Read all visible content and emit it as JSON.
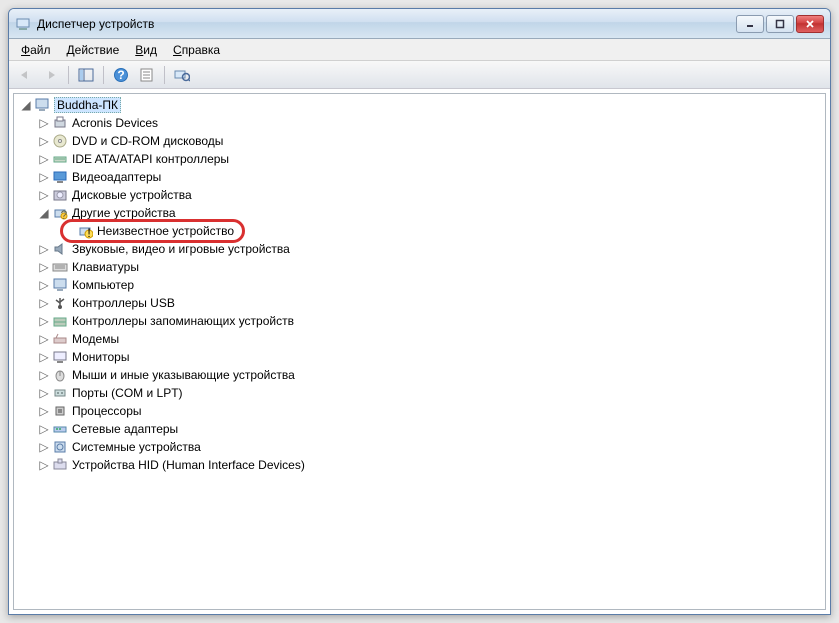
{
  "window": {
    "title": "Диспетчер устройств"
  },
  "menu": {
    "file": "Файл",
    "action": "Действие",
    "view": "Вид",
    "help": "Справка"
  },
  "tree": {
    "root": "Buddha-ПК",
    "nodes": [
      {
        "label": "Acronis Devices",
        "expandable": true,
        "icon": "printer"
      },
      {
        "label": "DVD и CD-ROM дисководы",
        "expandable": true,
        "icon": "cdrom"
      },
      {
        "label": "IDE ATA/ATAPI контроллеры",
        "expandable": true,
        "icon": "ide"
      },
      {
        "label": "Видеоадаптеры",
        "expandable": true,
        "icon": "display"
      },
      {
        "label": "Дисковые устройства",
        "expandable": true,
        "icon": "disk"
      },
      {
        "label": "Другие устройства",
        "expandable": true,
        "expanded": true,
        "icon": "other",
        "children": [
          {
            "label": "Неизвестное устройство",
            "icon": "unknown",
            "highlight": true
          }
        ]
      },
      {
        "label": "Звуковые, видео и игровые устройства",
        "expandable": true,
        "icon": "sound"
      },
      {
        "label": "Клавиатуры",
        "expandable": true,
        "icon": "keyboard"
      },
      {
        "label": "Компьютер",
        "expandable": true,
        "icon": "computer"
      },
      {
        "label": "Контроллеры USB",
        "expandable": true,
        "icon": "usb"
      },
      {
        "label": "Контроллеры запоминающих устройств",
        "expandable": true,
        "icon": "storage"
      },
      {
        "label": "Модемы",
        "expandable": true,
        "icon": "modem"
      },
      {
        "label": "Мониторы",
        "expandable": true,
        "icon": "monitor"
      },
      {
        "label": "Мыши и иные указывающие устройства",
        "expandable": true,
        "icon": "mouse"
      },
      {
        "label": "Порты (COM и LPT)",
        "expandable": true,
        "icon": "ports"
      },
      {
        "label": "Процессоры",
        "expandable": true,
        "icon": "cpu"
      },
      {
        "label": "Сетевые адаптеры",
        "expandable": true,
        "icon": "network"
      },
      {
        "label": "Системные устройства",
        "expandable": true,
        "icon": "system"
      },
      {
        "label": "Устройства HID (Human Interface Devices)",
        "expandable": true,
        "icon": "hid"
      }
    ]
  }
}
